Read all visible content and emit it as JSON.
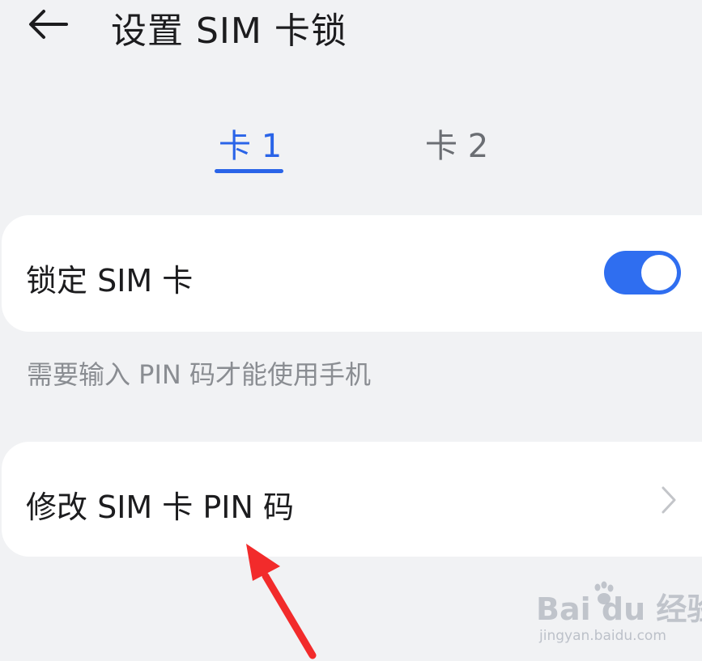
{
  "header": {
    "back_icon": "arrow-left-icon",
    "title": "设置 SIM 卡锁"
  },
  "tabs": [
    {
      "label": "卡 1",
      "selected": true
    },
    {
      "label": "卡 2",
      "selected": false
    }
  ],
  "lock_sim": {
    "label": "锁定 SIM 卡",
    "toggle_on": true,
    "hint": "需要输入 PIN 码才能使用手机"
  },
  "change_pin": {
    "label": "修改 SIM 卡 PIN 码",
    "chevron_icon": "chevron-right-icon"
  },
  "watermark": {
    "brand": "Bai du 经验",
    "url": "jingyan.baidu.com"
  },
  "colors": {
    "accent": "#2a64e8",
    "toggle_on": "#2f6ef0",
    "background": "#f1f2f4",
    "annotation_arrow": "#f22b2b"
  }
}
